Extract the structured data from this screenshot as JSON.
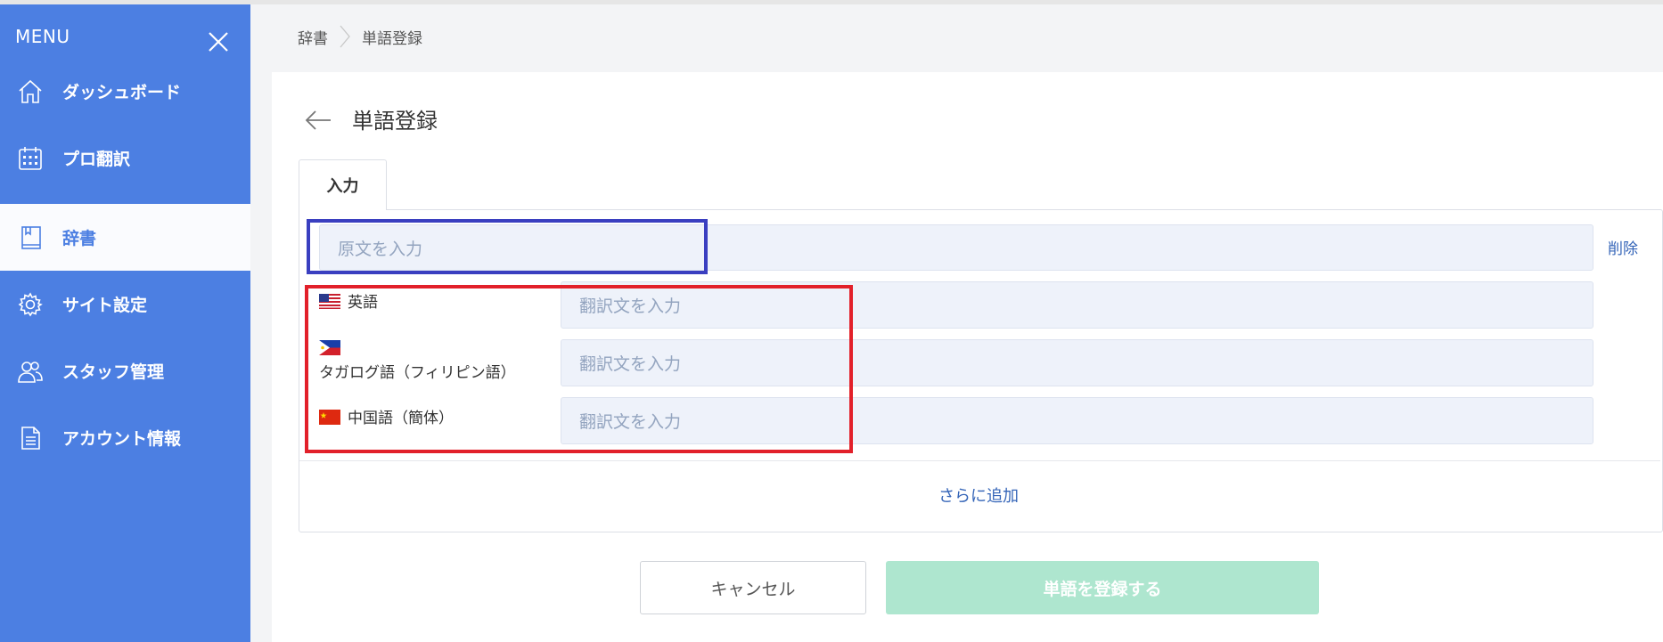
{
  "sidebar": {
    "menu_label": "MENU",
    "accent_color": "#4c7fe2",
    "items": [
      {
        "label": "ダッシュボード",
        "icon": "home-icon"
      },
      {
        "label": "プロ翻訳",
        "icon": "calendar-icon"
      },
      {
        "label": "辞書",
        "icon": "book-icon",
        "active": true
      },
      {
        "label": "サイト設定",
        "icon": "gear-icon"
      },
      {
        "label": "スタッフ管理",
        "icon": "users-icon"
      },
      {
        "label": "アカウント情報",
        "icon": "document-icon"
      }
    ]
  },
  "breadcrumb": {
    "items": [
      "辞書",
      "単語登録"
    ]
  },
  "page": {
    "title": "単語登録"
  },
  "tabs": [
    {
      "label": "入力"
    }
  ],
  "form": {
    "source_placeholder": "原文を入力",
    "delete_label": "削除",
    "translations": [
      {
        "language": "英語",
        "flag": "us-flag-icon",
        "placeholder": "翻訳文を入力"
      },
      {
        "language": "タガログ語（フィリピン語）",
        "flag": "philippines-flag-icon",
        "placeholder": "翻訳文を入力"
      },
      {
        "language": "中国語（簡体）",
        "flag": "china-flag-icon",
        "placeholder": "翻訳文を入力"
      }
    ],
    "add_more_label": "さらに追加"
  },
  "actions": {
    "cancel_label": "キャンセル",
    "submit_label": "単語を登録する",
    "submit_color": "#aee6cf"
  },
  "highlights": {
    "source_box_color": "#3a3fc0",
    "translations_box_color": "#e2202a"
  }
}
